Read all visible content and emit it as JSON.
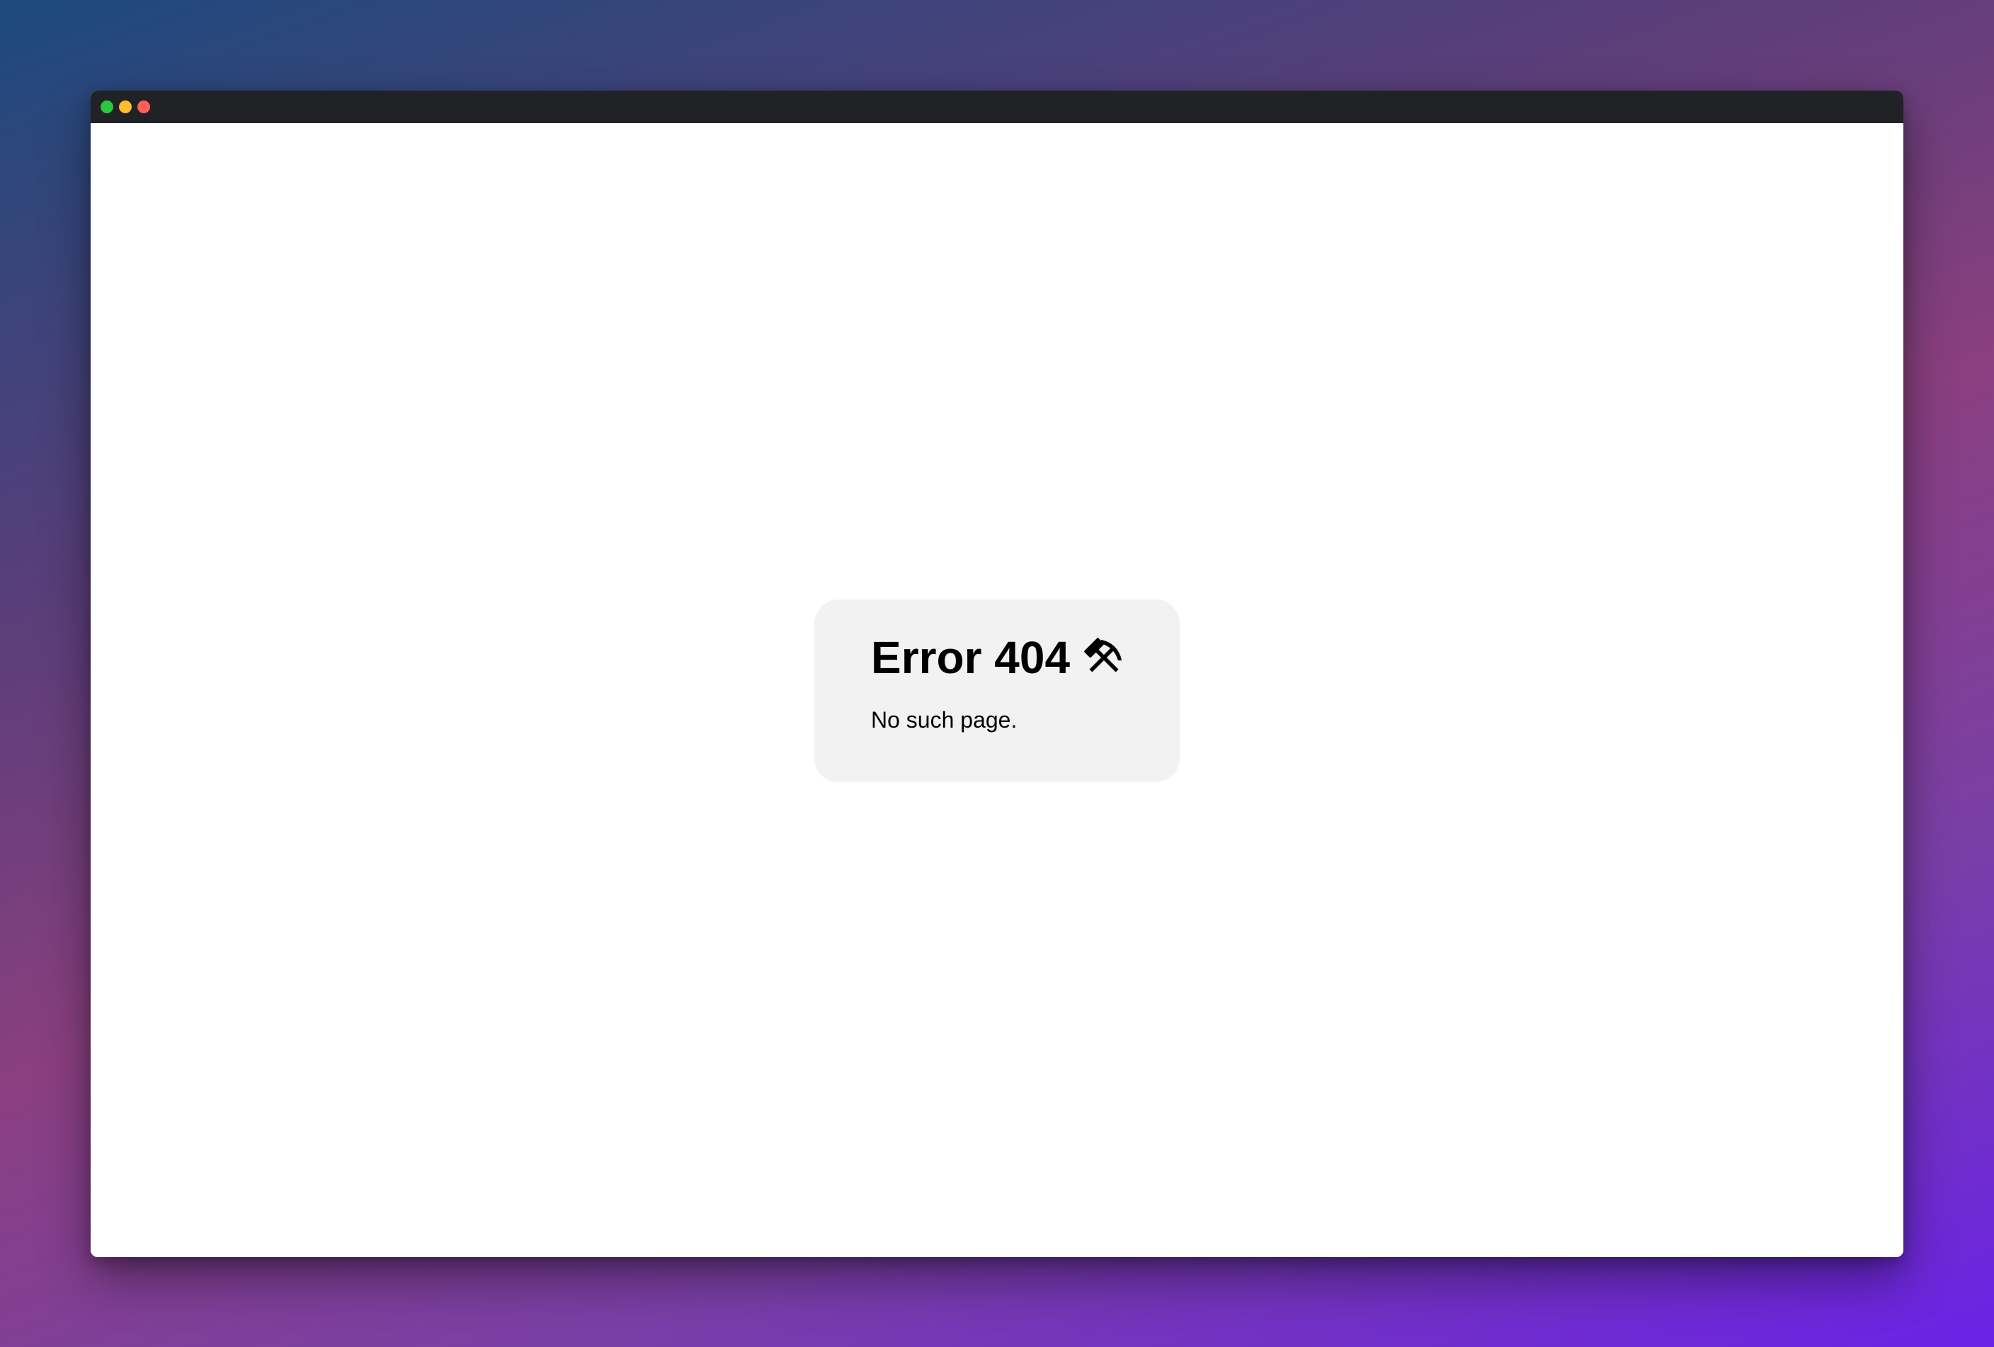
{
  "window": {
    "controls": [
      {
        "name": "green",
        "color": "#2ac840"
      },
      {
        "name": "yellow",
        "color": "#febc2e"
      },
      {
        "name": "red",
        "color": "#ff5f57"
      }
    ]
  },
  "error_card": {
    "title": "Error 404",
    "icon": "hammer-and-pick-icon",
    "message": "No such page."
  }
}
